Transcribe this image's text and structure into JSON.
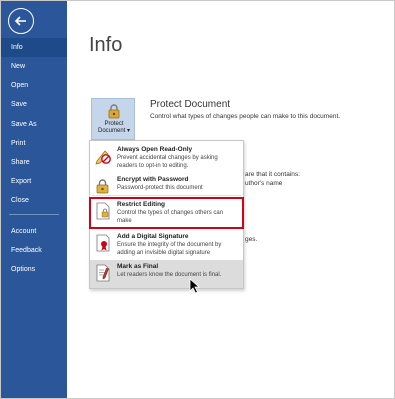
{
  "nav": {
    "items": [
      {
        "label": "Info",
        "active": true
      },
      {
        "label": "New"
      },
      {
        "label": "Open"
      },
      {
        "label": "Save"
      },
      {
        "label": "Save As"
      },
      {
        "label": "Print"
      },
      {
        "label": "Share"
      },
      {
        "label": "Export"
      },
      {
        "label": "Close"
      },
      {
        "label": "Account"
      },
      {
        "label": "Feedback"
      },
      {
        "label": "Options"
      }
    ]
  },
  "main": {
    "title": "Info",
    "protect": {
      "button_line1": "Protect",
      "button_line2": "Document ▾",
      "heading": "Protect Document",
      "description": "Control what types of changes people can make to this document."
    },
    "background_text": {
      "line1": "are that it contains:",
      "line2": "uthor's name",
      "line3": "ges."
    }
  },
  "menu": {
    "items": [
      {
        "title": "Always Open Read-Only",
        "desc": "Prevent accidental changes by asking readers to opt-in to editing."
      },
      {
        "title": "Encrypt with Password",
        "desc": "Password-protect this document"
      },
      {
        "title": "Restrict Editing",
        "desc": "Control the types of changes others can make"
      },
      {
        "title": "Add a Digital Signature",
        "desc": "Ensure the integrity of the document by adding an invisible digital signature"
      },
      {
        "title": "Mark as Final",
        "desc": "Let readers know the document is final."
      }
    ]
  },
  "colors": {
    "nav_bg": "#2b579a",
    "highlight_border": "#d0021b",
    "hover_bg": "#dcdcdc"
  }
}
